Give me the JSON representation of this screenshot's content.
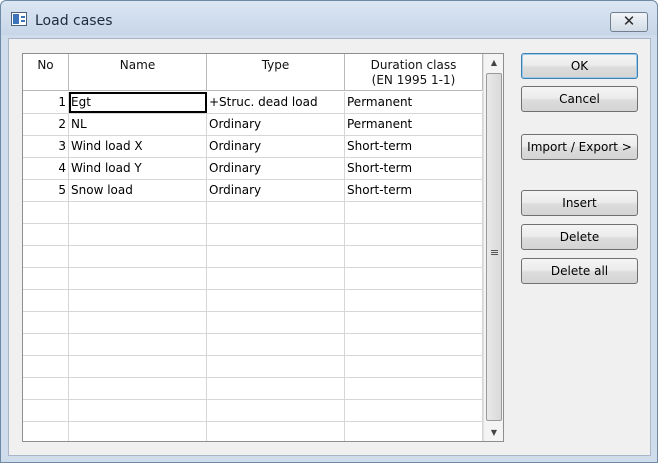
{
  "window": {
    "title": "Load cases"
  },
  "table": {
    "columns": [
      {
        "label": "No"
      },
      {
        "label": "Name"
      },
      {
        "label": "Type"
      },
      {
        "label": "Duration class",
        "sub": "(EN 1995 1-1)"
      }
    ],
    "rows": [
      {
        "no": "1",
        "name": "Egt",
        "type": "+Struc. dead load",
        "duration": "Permanent"
      },
      {
        "no": "2",
        "name": "NL",
        "type": "Ordinary",
        "duration": "Permanent"
      },
      {
        "no": "3",
        "name": "Wind load X",
        "type": "Ordinary",
        "duration": "Short-term"
      },
      {
        "no": "4",
        "name": "Wind load Y",
        "type": "Ordinary",
        "duration": "Short-term"
      },
      {
        "no": "5",
        "name": "Snow load",
        "type": "Ordinary",
        "duration": "Short-term"
      },
      {
        "no": "",
        "name": "",
        "type": "",
        "duration": ""
      },
      {
        "no": "",
        "name": "",
        "type": "",
        "duration": ""
      },
      {
        "no": "",
        "name": "",
        "type": "",
        "duration": ""
      },
      {
        "no": "",
        "name": "",
        "type": "",
        "duration": ""
      },
      {
        "no": "",
        "name": "",
        "type": "",
        "duration": ""
      },
      {
        "no": "",
        "name": "",
        "type": "",
        "duration": ""
      },
      {
        "no": "",
        "name": "",
        "type": "",
        "duration": ""
      },
      {
        "no": "",
        "name": "",
        "type": "",
        "duration": ""
      },
      {
        "no": "",
        "name": "",
        "type": "",
        "duration": ""
      },
      {
        "no": "",
        "name": "",
        "type": "",
        "duration": ""
      },
      {
        "no": "",
        "name": "",
        "type": "",
        "duration": ""
      }
    ]
  },
  "buttons": {
    "ok": "OK",
    "cancel": "Cancel",
    "import_export": "Import / Export >",
    "insert": "Insert",
    "delete": "Delete",
    "delete_all": "Delete all"
  },
  "icons": {
    "app": "window-app-icon",
    "close": "close-icon",
    "scroll_up": "scroll-up-arrow-icon",
    "scroll_down": "scroll-down-arrow-icon"
  }
}
